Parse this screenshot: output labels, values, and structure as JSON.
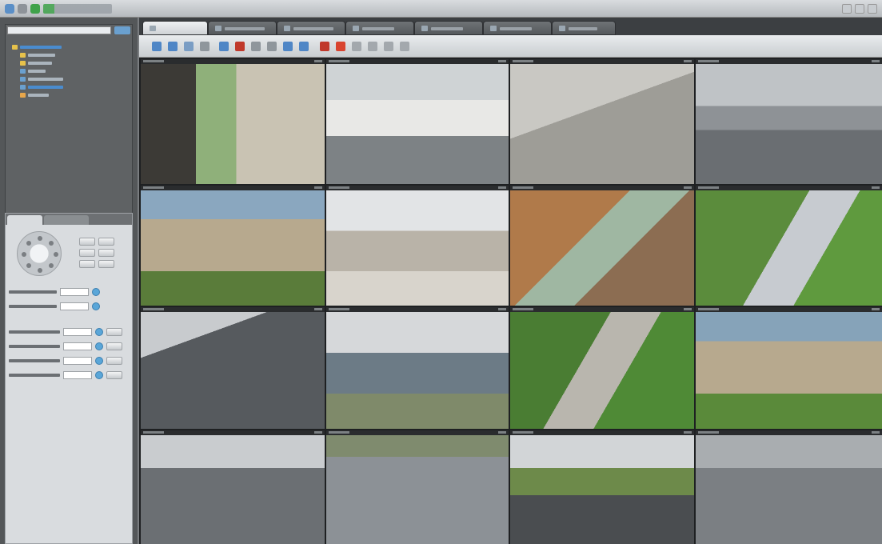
{
  "colors": {
    "app_accent": "#3fa24a",
    "tree_highlight": "#4a8ccf",
    "knob_blue": "#5aa6d8",
    "record_red": "#c0392b"
  },
  "titlebar": {
    "icons": [
      "app-logo-icon",
      "minimize-icon",
      "maximize-icon",
      "close-icon"
    ]
  },
  "camera_tree": {
    "icons": [
      "folder-icon",
      "camera-icon",
      "map-icon"
    ]
  },
  "ptz": {
    "icons": [
      "ptz-dpad-icon",
      "zoom-in-icon",
      "zoom-out-icon",
      "focus-icon",
      "iris-icon"
    ]
  },
  "tabs": {
    "count": 7,
    "active_index": 0
  },
  "toolbar": {
    "icons": [
      "layout-1x1-icon",
      "layout-2x2-icon",
      "layout-3x3-icon",
      "layout-4x4-icon",
      "fullscreen-icon",
      "record-icon",
      "snapshot-icon",
      "playback-icon",
      "alarm-icon",
      "settings-icon"
    ]
  },
  "video_grid": {
    "rows": 4,
    "cols": 4,
    "scenes": [
      "office-window",
      "lab-desk",
      "corridor-floor",
      "parking-garage",
      "mall-crowd-left",
      "mall-crowd-center",
      "escalator-atrium",
      "lawn-corner",
      "parking-car-top",
      "city-rooftop-view",
      "garden-path",
      "mall-crowd-right",
      "parking-lot-car",
      "wet-plaza",
      "building-courtyard",
      "parking-ramp"
    ]
  }
}
